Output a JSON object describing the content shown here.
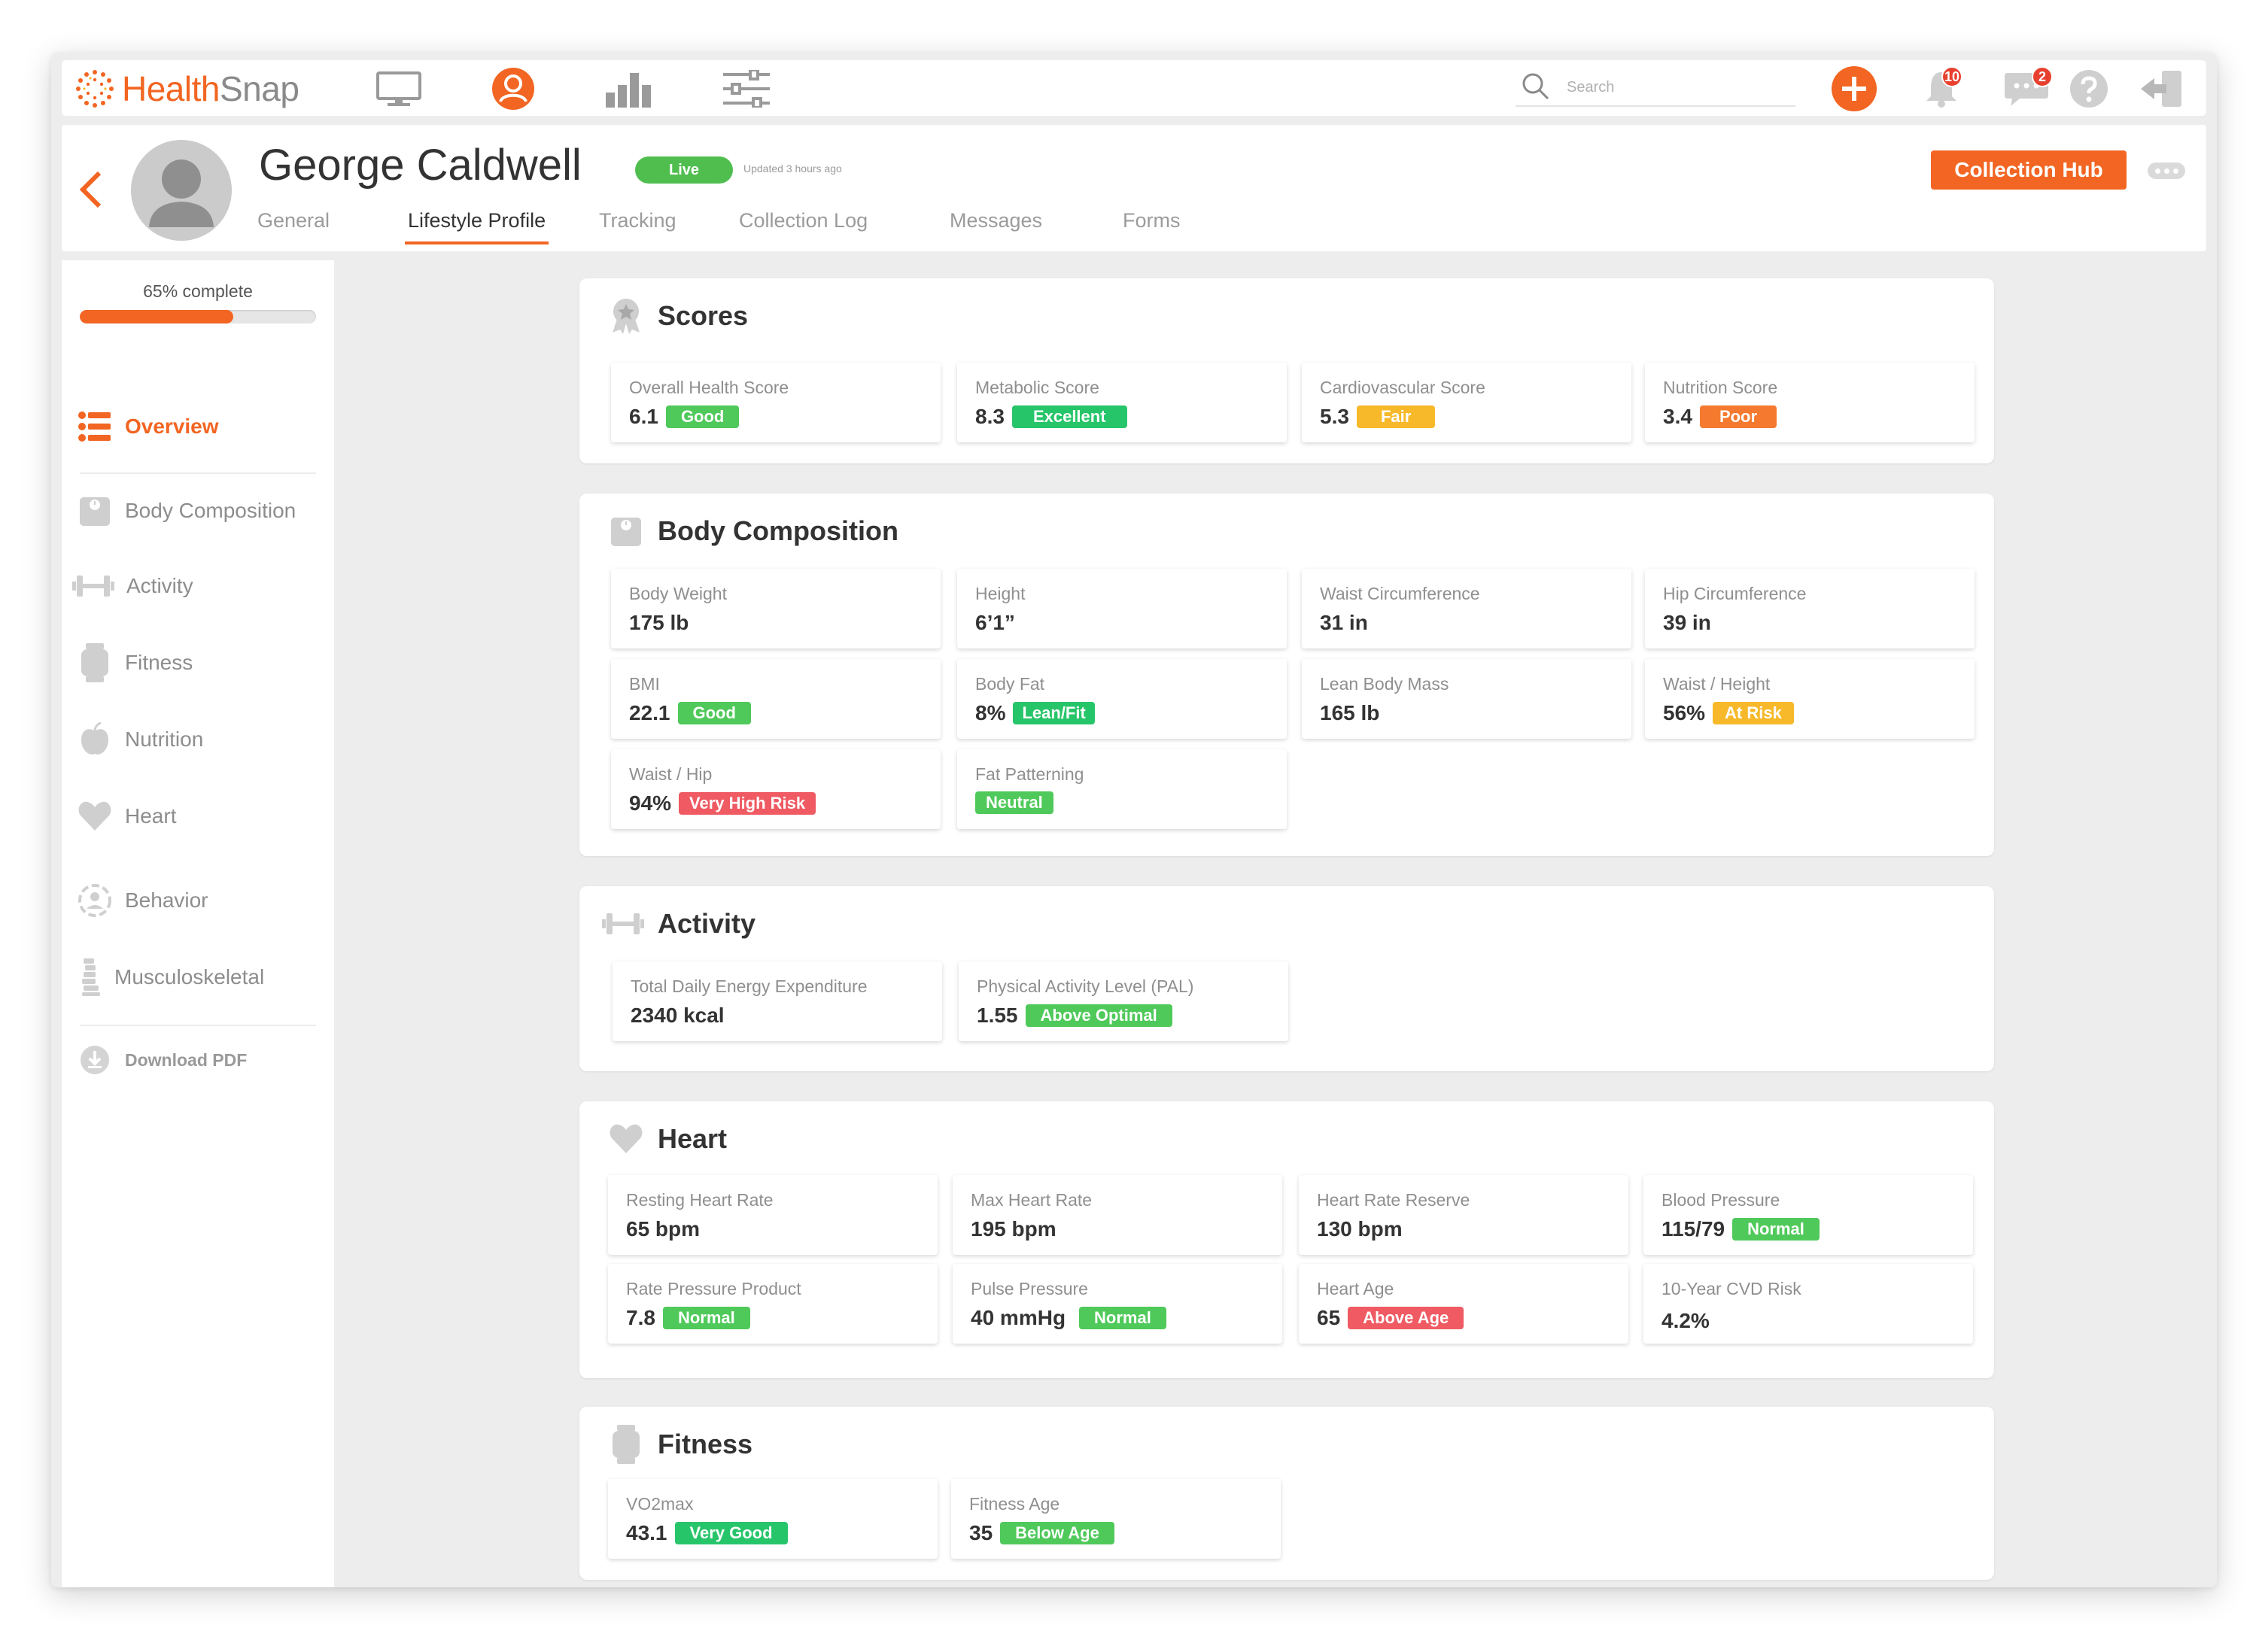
{
  "brand": {
    "name_health": "Health",
    "name_snap": "Snap",
    "accent": "#f26522"
  },
  "topbar": {
    "nav_icons": [
      "monitor-icon",
      "user-icon",
      "bar-chart-icon",
      "sliders-icon"
    ],
    "search_placeholder": "Search",
    "notifications_count": "10",
    "messages_count": "2"
  },
  "patient": {
    "name": "George Caldwell",
    "status": "Live",
    "updated": "Updated 3 hours ago",
    "collection_hub": "Collection Hub"
  },
  "tabs": [
    "General",
    "Lifestyle Profile",
    "Tracking",
    "Collection Log",
    "Messages",
    "Forms"
  ],
  "active_tab": "Lifestyle Profile",
  "sidebar": {
    "progress_label": "65% complete",
    "progress": 0.65,
    "items": [
      "Overview",
      "Body Composition",
      "Activity",
      "Fitness",
      "Nutrition",
      "Heart",
      "Behavior",
      "Musculoskeletal"
    ],
    "download": "Download PDF"
  },
  "sections": {
    "scores": {
      "title": "Scores",
      "metrics": [
        {
          "label": "Overall Health Score",
          "value": "6.1",
          "status": "Good",
          "color": "#4fc95a"
        },
        {
          "label": "Metabolic Score",
          "value": "8.3",
          "status": "Excellent",
          "color": "#27c56a"
        },
        {
          "label": "Cardiovascular Score",
          "value": "5.3",
          "status": "Fair",
          "color": "#f7b92a"
        },
        {
          "label": "Nutrition Score",
          "value": "3.4",
          "status": "Poor",
          "color": "#f5792e"
        }
      ]
    },
    "body": {
      "title": "Body Composition",
      "metrics": [
        {
          "label": "Body Weight",
          "value": "175 lb"
        },
        {
          "label": "Height",
          "value": "6’1”"
        },
        {
          "label": "Waist Circumference",
          "value": "31 in"
        },
        {
          "label": "Hip Circumference",
          "value": "39 in"
        },
        {
          "label": "BMI",
          "value": "22.1",
          "status": "Good"
        },
        {
          "label": "Body Fat",
          "value": "8%",
          "status": "Lean/Fit"
        },
        {
          "label": "Lean Body Mass",
          "value": "165 lb"
        },
        {
          "label": "Waist / Height",
          "value": "56%",
          "status": "At Risk"
        },
        {
          "label": "Waist / Hip",
          "value": "94%",
          "status": "Very High Risk"
        },
        {
          "label": "Fat Patterning",
          "value": "",
          "status": "Neutral"
        }
      ]
    },
    "activity": {
      "title": "Activity",
      "metrics": [
        {
          "label": "Total Daily Energy Expenditure",
          "value": "2340 kcal"
        },
        {
          "label": "Physical Activity Level (PAL)",
          "value": "1.55",
          "status": "Above Optimal"
        }
      ]
    },
    "heart": {
      "title": "Heart",
      "metrics": [
        {
          "label": "Resting Heart Rate",
          "value": "65 bpm"
        },
        {
          "label": "Max Heart Rate",
          "value": "195 bpm"
        },
        {
          "label": "Heart Rate Reserve",
          "value": "130 bpm"
        },
        {
          "label": "Blood Pressure",
          "value": "115/79",
          "status": "Normal"
        },
        {
          "label": "Rate Pressure Product",
          "value": "7.8",
          "status": "Normal"
        },
        {
          "label": "Pulse Pressure",
          "value": "40 mmHg",
          "status": "Normal"
        },
        {
          "label": "Heart Age",
          "value": "65",
          "status": "Above Age"
        },
        {
          "label": "10-Year CVD Risk",
          "value": "4.2%"
        }
      ]
    },
    "fitness": {
      "title": "Fitness",
      "metrics": [
        {
          "label": "VO2max",
          "value": "43.1",
          "status": "Very Good"
        },
        {
          "label": "Fitness Age",
          "value": "35",
          "status": "Below Age"
        }
      ]
    }
  }
}
